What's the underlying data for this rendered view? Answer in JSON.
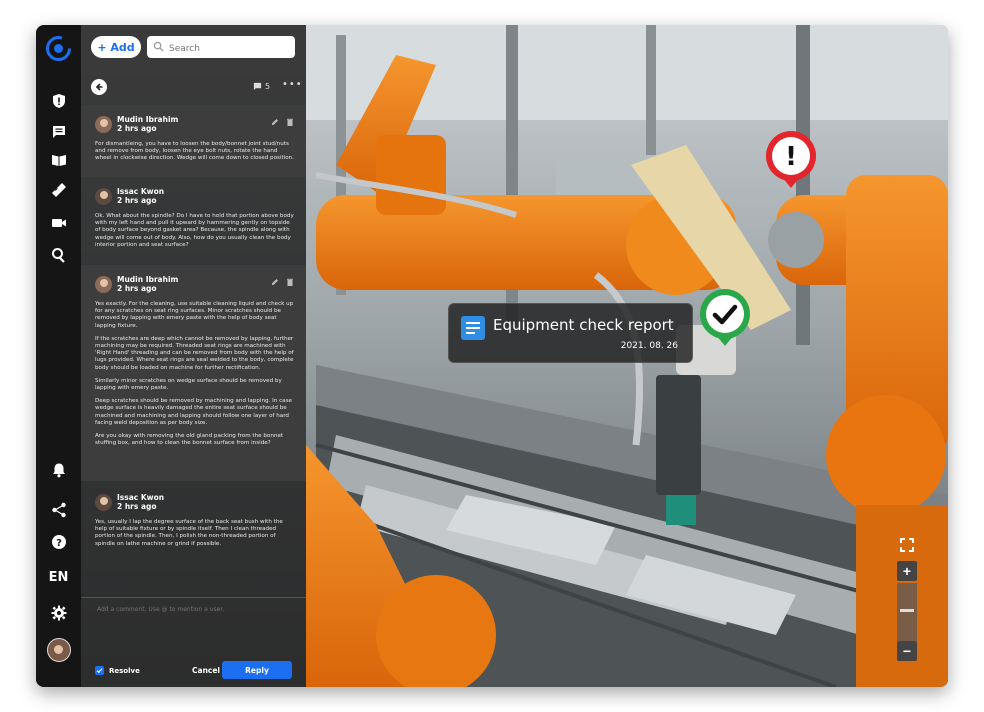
{
  "sidebar": {
    "language": "EN",
    "icons": [
      "logo-icon",
      "shield-alert-icon",
      "comment-icon",
      "book-icon",
      "ruler-icon",
      "video-icon",
      "search-icon",
      "bell-icon",
      "share-icon",
      "help-icon",
      "settings-icon",
      "user-avatar"
    ]
  },
  "toolbar": {
    "add_label": "+ Add",
    "search_placeholder": "Search"
  },
  "thread_header": {
    "comment_count": "5"
  },
  "comments": [
    {
      "author": "Mudin Ibrahim",
      "time": "2 hrs ago",
      "paragraphs": [
        "For dismantleing, you have to loosen the body/bonnet joint stud/nuts and remove from body, loosen the eye bolt nuts, rotate the hand wheel in clockwise direction. Wedge will come down to closed position."
      ]
    },
    {
      "author": "Issac Kwon",
      "time": "2 hrs ago",
      "paragraphs": [
        "Ok. What about the spindle? Do I have to hold that portion above body with my left hand and pull it upward by hammering gently on topside of body surface beyond gasket area? Because, the spindle along with wedge will come out of body. Also, how do you usually clean the body interior portion and seat surface?"
      ]
    },
    {
      "author": "Mudin Ibrahim",
      "time": "2 hrs ago",
      "paragraphs": [
        "Yes exactly. For the cleaning, use suitable cleaning liquid and check up for any scratches on seat ring surfaces. Minor scratches should be removed by lapping with emery paste with the help of body seat lapping fixture.",
        "If the scratches are deep which cannot be removed by lapping, further machining may be required. Threaded seat rings are machined with 'Right Hand' threading and can be removed from body with the help of lugs provided. Where seat rings are seal welded to the body, complete body should be loaded on machine for further rectification.",
        "Similarly minor scratches on wedge surface should be removed by lapping with emery paste.",
        "Deep scratches should be removed by machining and lapping. In case wedge surface is heavily damaged the entire seat surface should be machined and machining and lapping should follow one layer of hard facing weld deposition as per body size.",
        "Are you okay with removing the old gland packing from the bonnet stuffing box, and how to clean the bonnet surface from inside?"
      ]
    },
    {
      "author": "Issac Kwon",
      "time": "2 hrs ago",
      "paragraphs": [
        "Yes, usually I lap the degree surface of the back seat bush with the help of suitable fixture or by spindle itself. Then I clean threaded portion of the spindle. Then, I polish the non-threaded portion of spindle on lathe machine or grind if possible."
      ]
    }
  ],
  "composer": {
    "placeholder": "Add a comment. Use @ to mention a user.",
    "resolve_label": "Resolve",
    "cancel_label": "Cancel",
    "reply_label": "Reply"
  },
  "report_card": {
    "title": "Equipment check report",
    "date": "2021. 08. 26"
  },
  "markers": {
    "warning_symbol": "!",
    "warning_color": "#e3262b",
    "ok_color": "#2aa849"
  },
  "map_controls": {
    "zoom_in": "+",
    "zoom_out": "−"
  },
  "colors": {
    "accent": "#1d6ff2",
    "robot_orange": "#f07d12"
  }
}
